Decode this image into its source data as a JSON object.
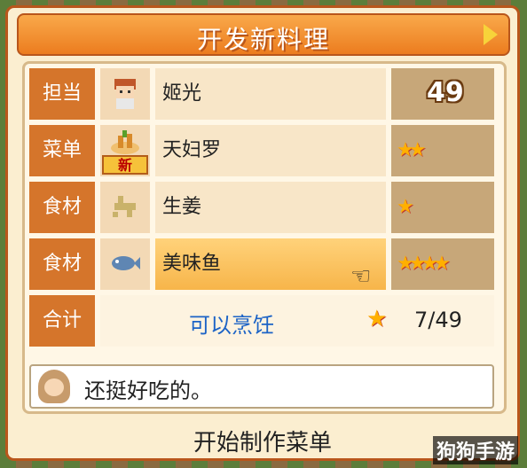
{
  "header": {
    "title": "开发新料理"
  },
  "rows": [
    {
      "label": "担当",
      "value": "姬光",
      "rating": "49",
      "stars": ""
    },
    {
      "label": "菜单",
      "value": "天妇罗",
      "badge": "新",
      "stars": "★★"
    },
    {
      "label": "食材",
      "value": "生姜",
      "stars": "★"
    },
    {
      "label": "食材",
      "value": "美味鱼",
      "stars": "★★★★"
    }
  ],
  "total": {
    "label": "合计",
    "status": "可以烹饪",
    "star": "★",
    "score": "7/49"
  },
  "message": {
    "text": "还挺好吃的。"
  },
  "footer": {
    "start_label": "开始制作菜单"
  },
  "watermark": {
    "text": "狗狗手游"
  }
}
